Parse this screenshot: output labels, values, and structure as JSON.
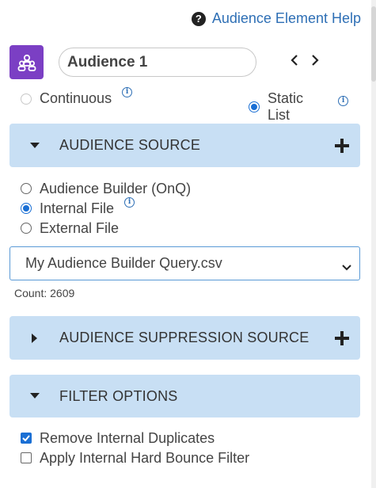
{
  "help": {
    "label": "Audience Element Help",
    "icon": "question-circle-icon"
  },
  "header": {
    "avatar_icon": "audience-group-icon",
    "avatar_color": "#7b3fc4",
    "name_value": "Audience 1",
    "prev_icon": "chevron-left-icon",
    "next_icon": "chevron-right-icon"
  },
  "mode": {
    "continuous_label": "Continuous",
    "static_label": "Static List",
    "selected": "Static List"
  },
  "audience_source": {
    "title": "AUDIENCE SOURCE",
    "expanded": true,
    "options": [
      {
        "label": "Audience Builder (OnQ)",
        "checked": false
      },
      {
        "label": "Internal File",
        "checked": true
      },
      {
        "label": "External File",
        "checked": false
      }
    ],
    "file_value": "My Audience Builder Query.csv",
    "count_text": "Count: 2609"
  },
  "suppression": {
    "title": "AUDIENCE SUPPRESSION SOURCE",
    "expanded": false
  },
  "filter": {
    "title": "FILTER OPTIONS",
    "expanded": true,
    "options": [
      {
        "label": "Remove Internal Duplicates",
        "checked": true
      },
      {
        "label": "Apply Internal Hard Bounce Filter",
        "checked": false
      }
    ]
  },
  "colors": {
    "accent": "#1a6fd4",
    "link": "#2e6fb5",
    "section_bg": "#c8dff4"
  }
}
